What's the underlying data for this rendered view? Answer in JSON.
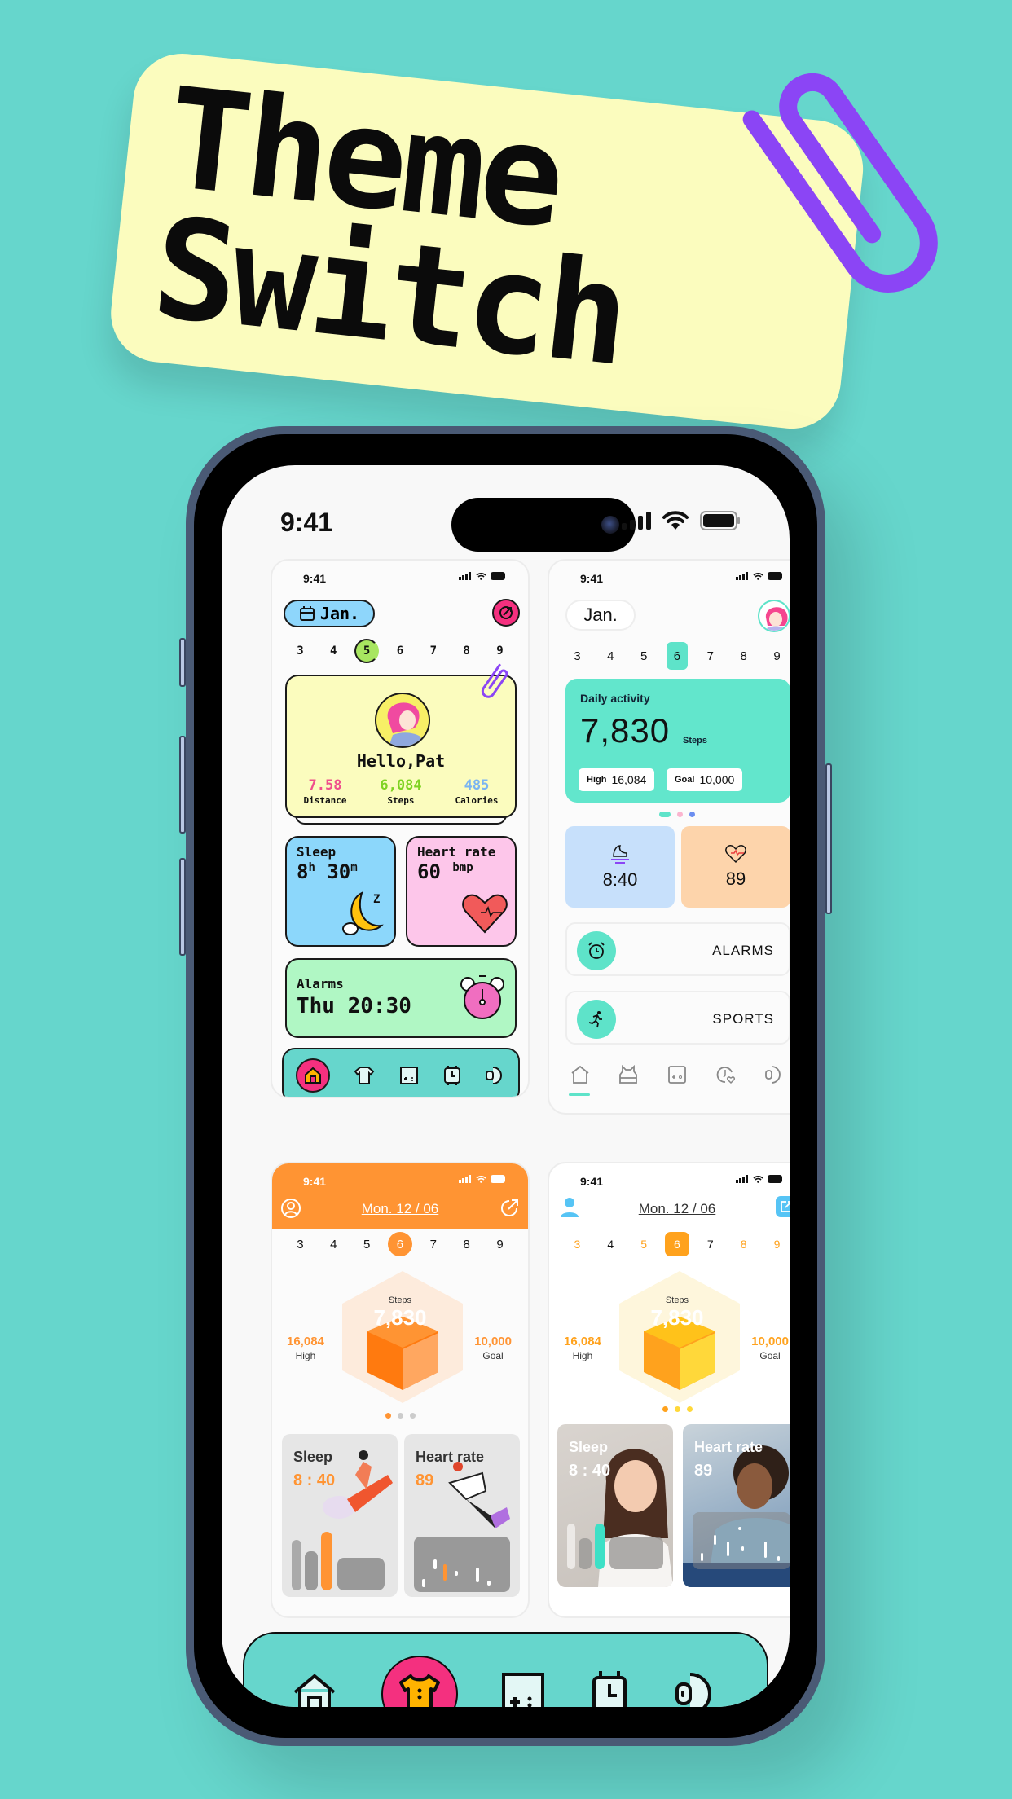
{
  "banner": {
    "line1": "Theme",
    "line2": "Switch",
    "background_color": "#fbfcbe",
    "clip_color": "#8b45f5"
  },
  "phone": {
    "status_time": "9:41",
    "status_icons": [
      "signal-icon",
      "wifi-icon",
      "battery-icon"
    ]
  },
  "themes": {
    "retro": {
      "status_time": "9:41",
      "month": "Jan.",
      "days": [
        "3",
        "4",
        "5",
        "6",
        "7",
        "8",
        "9"
      ],
      "selected_day": "5",
      "greeting": "Hello,Pat",
      "stats": [
        {
          "value": "7.58",
          "label": "Distance",
          "color": "#ef4f8c"
        },
        {
          "value": "6,084",
          "label": "Steps",
          "color": "#7ed321"
        },
        {
          "value": "485",
          "label": "Calories",
          "color": "#79b4f2"
        }
      ],
      "sleep": {
        "title": "Sleep",
        "hours": "8",
        "h_unit": "h",
        "minutes": "30",
        "m_unit": "m",
        "z": "Z"
      },
      "heart": {
        "title": "Heart rate",
        "value": "60",
        "unit": "bmp"
      },
      "alarm": {
        "title": "Alarms",
        "value": "Thu 20:30"
      },
      "nav": [
        "home",
        "shirt",
        "game",
        "watch",
        "earbud"
      ],
      "nav_selected": "home"
    },
    "mint": {
      "status_time": "9:41",
      "month": "Jan.",
      "days": [
        "3",
        "4",
        "5",
        "6",
        "7",
        "8",
        "9"
      ],
      "selected_day": "6",
      "daily": {
        "label": "Daily activity",
        "steps": "7,830",
        "unit": "Steps",
        "high_label": "High",
        "high_value": "16,084",
        "goal_label": "Goal",
        "goal_value": "10,000"
      },
      "carousel_dots": [
        "#5ee3c9",
        "#fbb5cf",
        "#6b8ef0"
      ],
      "sleep_value": "8:40",
      "heart_value": "89",
      "rows": [
        {
          "label": "ALARMS",
          "icon": "alarm-clock-icon"
        },
        {
          "label": "SPORTS",
          "icon": "running-icon"
        }
      ],
      "nav": [
        "home",
        "vest",
        "game",
        "watch-heart",
        "earbud"
      ],
      "nav_selected": "home",
      "accent": "#5ee3c9"
    },
    "orange": {
      "status_time": "9:41",
      "date": "Mon.  12  /  06",
      "days": [
        "3",
        "4",
        "5",
        "6",
        "7",
        "8",
        "9"
      ],
      "selected_day": "6",
      "steps_label": "Steps",
      "steps_value": "7,830",
      "high_value": "16,084",
      "high_label": "High",
      "goal_value": "10,000",
      "goal_label": "Goal",
      "sleep": {
        "title": "Sleep",
        "value": "8 : 40"
      },
      "heart": {
        "title": "Heart rate",
        "value": "89"
      },
      "accent": "#ff9433"
    },
    "yellow": {
      "status_time": "9:41",
      "date": "Mon.  12  /  06",
      "days": [
        "3",
        "4",
        "5",
        "6",
        "7",
        "8",
        "9"
      ],
      "selected_day": "6",
      "steps_label": "Steps",
      "steps_value": "7,830",
      "high_value": "16,084",
      "high_label": "High",
      "goal_value": "10,000",
      "goal_label": "Goal",
      "sleep": {
        "title": "Sleep",
        "value": "8 : 40"
      },
      "heart": {
        "title": "Heart rate",
        "value": "89"
      },
      "accent": "#ffa21d"
    }
  },
  "bottom_nav": {
    "items": [
      "home",
      "shirt",
      "game",
      "watch",
      "earbud"
    ],
    "selected": "shirt"
  }
}
